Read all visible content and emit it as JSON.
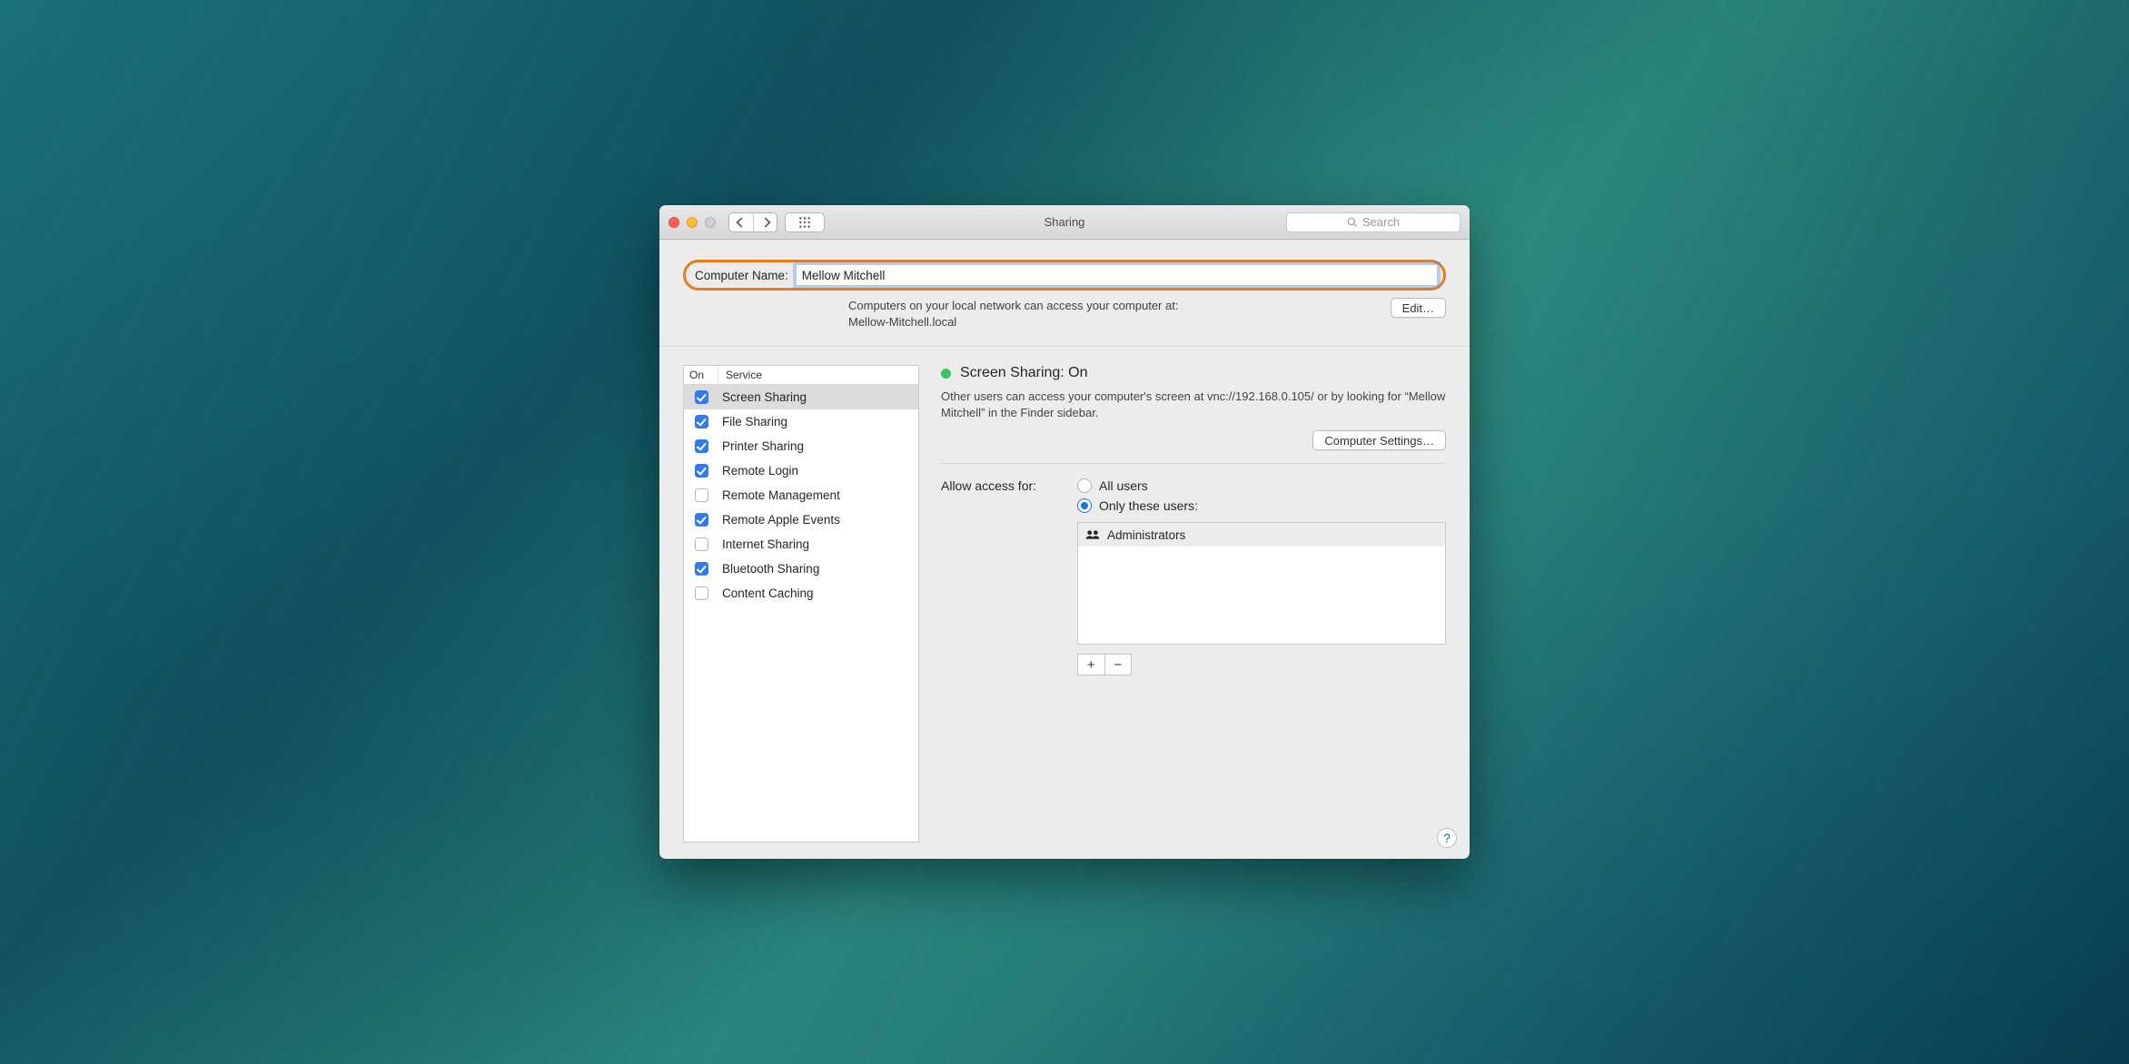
{
  "toolbar": {
    "window_title": "Sharing",
    "search_placeholder": "Search"
  },
  "computer_name": {
    "label": "Computer Name:",
    "value": "Mellow Mitchell",
    "access_text_line1": "Computers on your local network can access your computer at:",
    "access_text_line2": "Mellow-Mitchell.local",
    "edit_label": "Edit…"
  },
  "services": {
    "header_on": "On",
    "header_service": "Service",
    "items": [
      {
        "label": "Screen Sharing",
        "checked": true,
        "selected": true
      },
      {
        "label": "File Sharing",
        "checked": true,
        "selected": false
      },
      {
        "label": "Printer Sharing",
        "checked": true,
        "selected": false
      },
      {
        "label": "Remote Login",
        "checked": true,
        "selected": false
      },
      {
        "label": "Remote Management",
        "checked": false,
        "selected": false
      },
      {
        "label": "Remote Apple Events",
        "checked": true,
        "selected": false
      },
      {
        "label": "Internet Sharing",
        "checked": false,
        "selected": false
      },
      {
        "label": "Bluetooth Sharing",
        "checked": true,
        "selected": false
      },
      {
        "label": "Content Caching",
        "checked": false,
        "selected": false
      }
    ]
  },
  "detail": {
    "status_title": "Screen Sharing: On",
    "description": "Other users can access your computer's screen at vnc://192.168.0.105/ or by looking for “Mellow Mitchell” in the Finder sidebar.",
    "computer_settings_label": "Computer Settings…",
    "allow_access_label": "Allow access for:",
    "option_all": "All users",
    "option_only": "Only these users:",
    "selected_option": "only",
    "users": [
      {
        "label": "Administrators"
      }
    ],
    "plus": "+",
    "minus": "−"
  },
  "help": "?"
}
